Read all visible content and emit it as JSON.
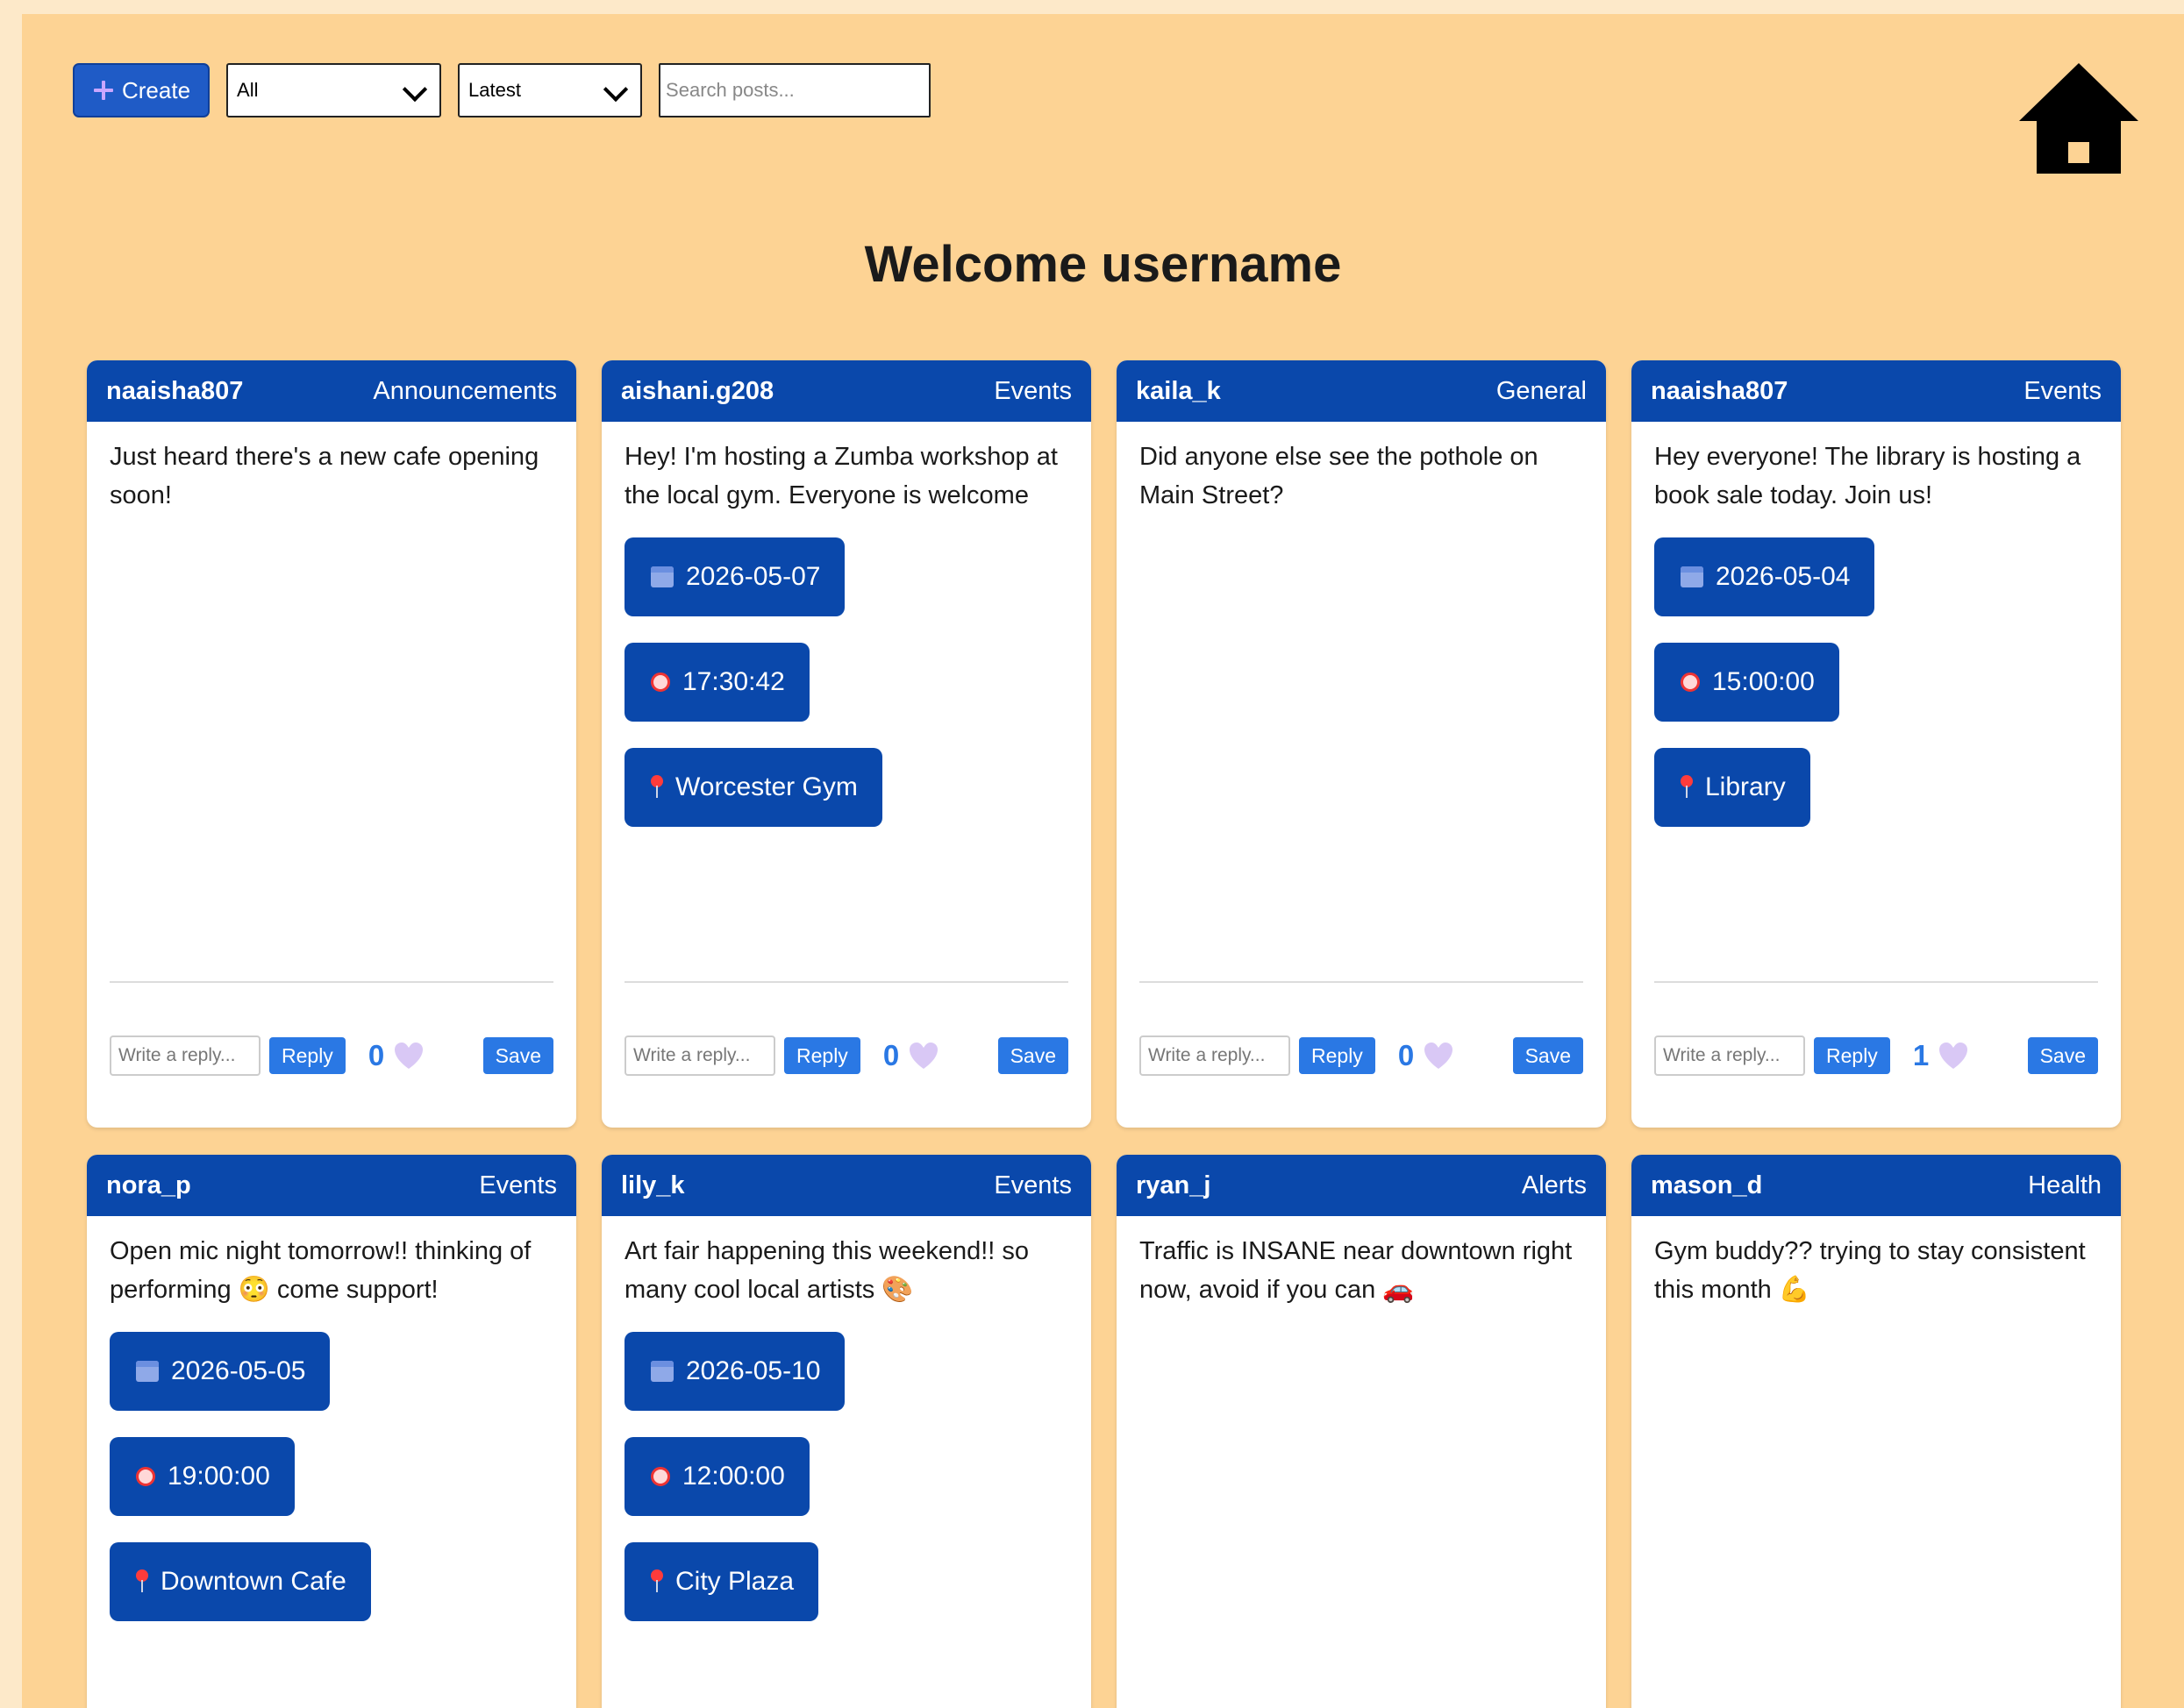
{
  "toolbar": {
    "create_label": "Create",
    "filter_value": "All",
    "sort_value": "Latest",
    "search_placeholder": "Search posts..."
  },
  "welcome_title": "Welcome username",
  "reply_placeholder": "Write a reply...",
  "reply_label": "Reply",
  "save_label": "Save",
  "posts": [
    {
      "user": "naaisha807",
      "category": "Announcements",
      "text": "Just heard there's a new cafe opening soon!",
      "likes": "0"
    },
    {
      "user": "aishani.g208",
      "category": "Events",
      "text": "Hey! I'm hosting a Zumba workshop at the local gym. Everyone is welcome",
      "date": "2026-05-07",
      "time": "17:30:42",
      "location": "Worcester Gym",
      "likes": "0"
    },
    {
      "user": "kaila_k",
      "category": "General",
      "text": "Did anyone else see the pothole on Main Street?",
      "likes": "0"
    },
    {
      "user": "naaisha807",
      "category": "Events",
      "text": "Hey everyone! The library is hosting a book sale today. Join us!",
      "date": "2026-05-04",
      "time": "15:00:00",
      "location": "Library",
      "likes": "1"
    },
    {
      "user": "nora_p",
      "category": "Events",
      "text": "Open mic night tomorrow!! thinking of performing 😳 come support!",
      "date": "2026-05-05",
      "time": "19:00:00",
      "location": "Downtown Cafe"
    },
    {
      "user": "lily_k",
      "category": "Events",
      "text": "Art fair happening this weekend!! so many cool local artists 🎨",
      "date": "2026-05-10",
      "time": "12:00:00",
      "location": "City Plaza"
    },
    {
      "user": "ryan_j",
      "category": "Alerts",
      "text": "Traffic is INSANE near downtown right now, avoid if you can 🚗"
    },
    {
      "user": "mason_d",
      "category": "Health",
      "text": "Gym buddy?? trying to stay consistent this month 💪"
    }
  ]
}
